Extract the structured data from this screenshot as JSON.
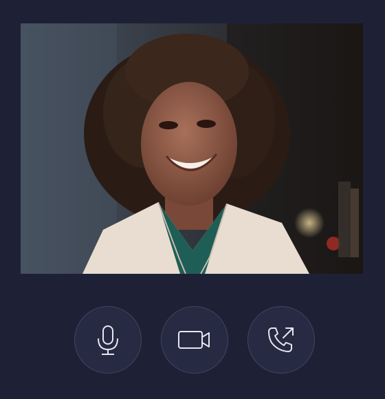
{
  "call": {
    "video_feed_icon": "participant-video",
    "controls": [
      {
        "icon": "microphone-icon",
        "action": "mute-microphone"
      },
      {
        "icon": "video-camera-icon",
        "action": "toggle-camera"
      },
      {
        "icon": "phone-outgoing-icon",
        "action": "call"
      }
    ]
  },
  "colors": {
    "background": "#1e2136",
    "button_fill": "#262a42",
    "button_border": "#41465f",
    "icon_stroke": "#e6e8f0"
  }
}
